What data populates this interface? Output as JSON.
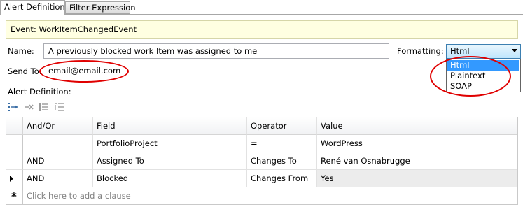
{
  "tabs": [
    {
      "label": "Alert Definition",
      "active": true
    },
    {
      "label": "Filter Expression",
      "active": false
    }
  ],
  "event_banner": "Event: WorkItemChangedEvent",
  "name_label": "Name:",
  "name_value": "A previously blocked work Item was assigned to me",
  "formatting_label": "Formatting:",
  "formatting_selected": "Html",
  "formatting_options": [
    "Html",
    "Plaintext",
    "SOAP"
  ],
  "send_to_label": "Send To:",
  "send_to_value": "email@email.com",
  "alert_definition_label": "Alert Definition:",
  "toolbar_icons": [
    "insert-clause-icon",
    "delete-clause-icon",
    "group-clauses-icon",
    "ungroup-clauses-icon"
  ],
  "grid": {
    "columns": [
      "And/Or",
      "Field",
      "Operator",
      "Value"
    ],
    "rows": [
      {
        "andor": "",
        "field": "PortfolioProject",
        "operator": "=",
        "value": "WordPress"
      },
      {
        "andor": "AND",
        "field": "Assigned To",
        "operator": "Changes To",
        "value": "René van Osnabrugge"
      },
      {
        "andor": "AND",
        "field": "Blocked",
        "operator": "Changes From",
        "value": "Yes"
      }
    ],
    "new_row_text": "Click here to add a clause"
  },
  "colors": {
    "banner_bg": "#ffffe1",
    "selection": "#3399ff",
    "annotation_ring": "#e00000"
  }
}
